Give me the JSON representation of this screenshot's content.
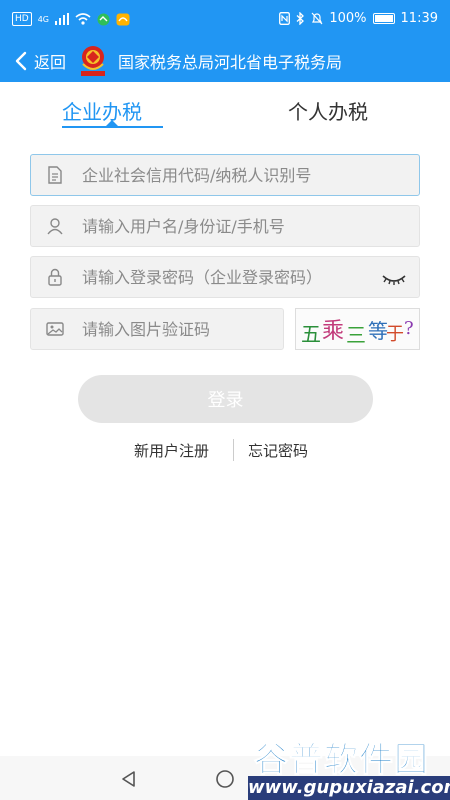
{
  "status_bar": {
    "network_left": "HD",
    "network_4g": "4G",
    "battery_percent": "100%",
    "time": "11:39"
  },
  "header": {
    "back_label": "返回",
    "title": "国家税务总局河北省电子税务局"
  },
  "tabs": {
    "enterprise": "企业办税",
    "personal": "个人办税"
  },
  "form": {
    "credit_code_placeholder": "企业社会信用代码/纳税人识别号",
    "username_placeholder": "请输入用户名/身份证/手机号",
    "password_placeholder": "请输入登录密码（企业登录密码）",
    "captcha_placeholder": "请输入图片验证码",
    "captcha_image_text": "五乘三等于?"
  },
  "login_button": "登录",
  "links": {
    "register": "新用户注册",
    "forgot": "忘记密码"
  },
  "watermark": {
    "brand": "谷普软件园",
    "url": "www.gupuxiazai.com"
  },
  "colors": {
    "primary": "#2196f3",
    "field_bg": "#f2f2f2",
    "button_disabled": "#e4e4e4"
  }
}
